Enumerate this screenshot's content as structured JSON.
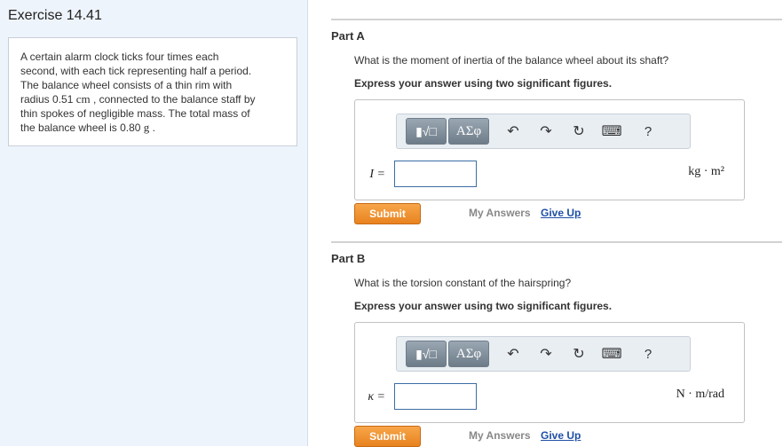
{
  "exercise": {
    "title": "Exercise 14.41",
    "problem": {
      "line1": "A certain alarm clock ticks four times each",
      "line2": "second, with each tick representing half a period.",
      "line3": "The balance wheel consists of a thin rim with",
      "line4_a": "radius 0.51",
      "line4_unit": "cm",
      "line4_b": ", connected to the balance staff by",
      "line5": "thin spokes of negligible mass. The total mass of",
      "line6_a": "the balance wheel is 0.80",
      "line6_unit": "g",
      "line6_b": "."
    }
  },
  "toolbar": {
    "templates_glyph": "▮√□",
    "greek_label": "ΑΣφ",
    "undo_glyph": "↶",
    "redo_glyph": "↷",
    "reset_glyph": "↻",
    "keyboard_glyph": "⌨",
    "help_label": "?"
  },
  "partA": {
    "label": "Part A",
    "question": "What is the moment of inertia of the balance wheel about its shaft?",
    "instruction": "Express your answer using two significant figures.",
    "lhs": "I =",
    "input_value": "",
    "units": "kg · m²",
    "submit_label": "Submit",
    "my_answers_label": "My Answers",
    "give_up_label": "Give Up"
  },
  "partB": {
    "label": "Part B",
    "question": "What is the torsion constant of the hairspring?",
    "instruction": "Express your answer using two significant figures.",
    "lhs": "κ =",
    "input_value": "",
    "units": "N · m/rad",
    "submit_label": "Submit",
    "my_answers_label": "My Answers",
    "give_up_label": "Give Up"
  },
  "colors": {
    "sidebar_bg": "#eef4fb",
    "submit_orange": "#e8831f",
    "link_blue": "#1f4fa6"
  }
}
